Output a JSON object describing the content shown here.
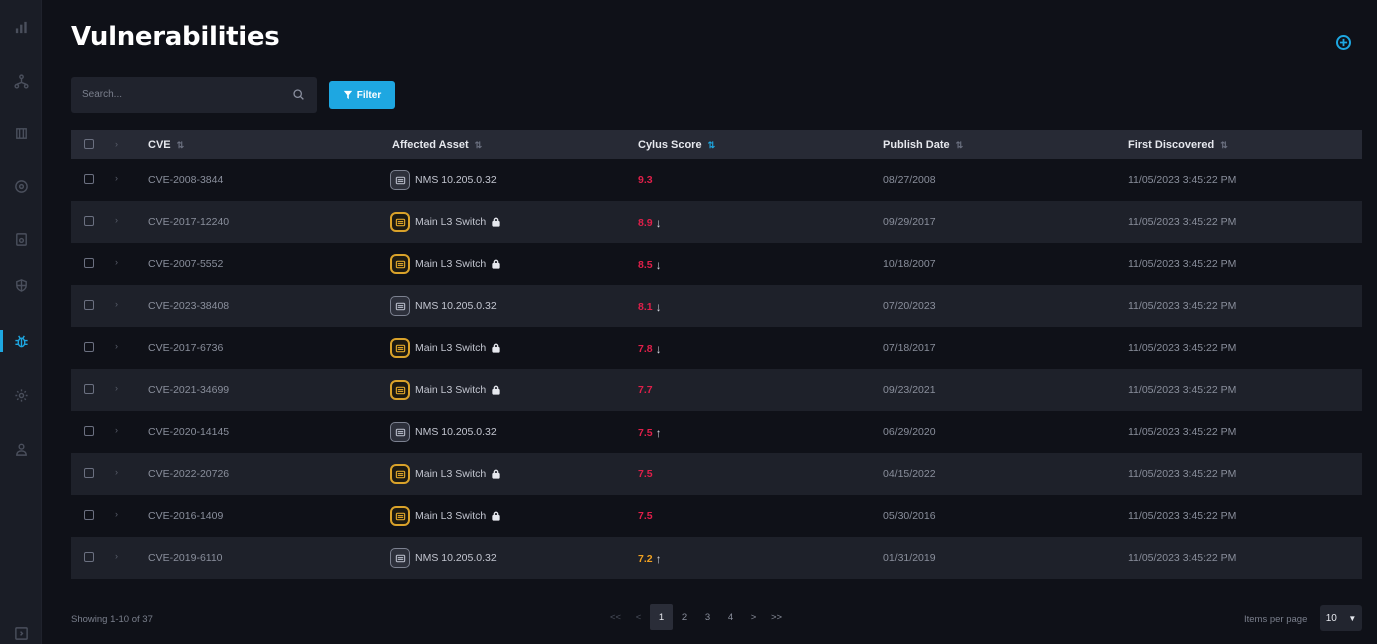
{
  "page": {
    "title": "Vulnerabilities"
  },
  "sidebar": {
    "items": [
      {
        "icon": "dashboard-icon"
      },
      {
        "icon": "topology-icon"
      },
      {
        "icon": "assets-icon"
      },
      {
        "icon": "threats-icon"
      },
      {
        "icon": "reports-icon"
      },
      {
        "icon": "protection-icon"
      },
      {
        "icon": "vulnerabilities-bug-icon",
        "active": true
      },
      {
        "icon": "settings-gear-icon"
      },
      {
        "icon": "users-icon"
      }
    ]
  },
  "search": {
    "placeholder": "Search..."
  },
  "filter": {
    "label": "Filter"
  },
  "table": {
    "columns": [
      "CVE",
      "Affected Asset",
      "Cylus Score",
      "Publish Date",
      "First Discovered"
    ],
    "rows": [
      {
        "cve": "CVE-2008-3844",
        "asset": "NMS 10.205.0.32",
        "asset_type": "gray",
        "locked": false,
        "score": "9.3",
        "color": "red",
        "trend": "",
        "publish": "08/27/2008",
        "discovered": "11/05/2023 3:45:22 PM"
      },
      {
        "cve": "CVE-2017-12240",
        "asset": "Main L3 Switch",
        "asset_type": "gold",
        "locked": true,
        "score": "8.9",
        "color": "red",
        "trend": "↓",
        "publish": "09/29/2017",
        "discovered": "11/05/2023 3:45:22 PM"
      },
      {
        "cve": "CVE-2007-5552",
        "asset": "Main L3 Switch",
        "asset_type": "gold",
        "locked": true,
        "score": "8.5",
        "color": "red",
        "trend": "↓",
        "publish": "10/18/2007",
        "discovered": "11/05/2023 3:45:22 PM"
      },
      {
        "cve": "CVE-2023-38408",
        "asset": "NMS 10.205.0.32",
        "asset_type": "gray",
        "locked": false,
        "score": "8.1",
        "color": "red",
        "trend": "↓",
        "publish": "07/20/2023",
        "discovered": "11/05/2023 3:45:22 PM"
      },
      {
        "cve": "CVE-2017-6736",
        "asset": "Main L3 Switch",
        "asset_type": "gold",
        "locked": true,
        "score": "7.8",
        "color": "red",
        "trend": "↓",
        "publish": "07/18/2017",
        "discovered": "11/05/2023 3:45:22 PM"
      },
      {
        "cve": "CVE-2021-34699",
        "asset": "Main L3 Switch",
        "asset_type": "gold",
        "locked": true,
        "score": "7.7",
        "color": "red",
        "trend": "",
        "publish": "09/23/2021",
        "discovered": "11/05/2023 3:45:22 PM"
      },
      {
        "cve": "CVE-2020-14145",
        "asset": "NMS 10.205.0.32",
        "asset_type": "gray",
        "locked": false,
        "score": "7.5",
        "color": "red",
        "trend": "↑",
        "publish": "06/29/2020",
        "discovered": "11/05/2023 3:45:22 PM"
      },
      {
        "cve": "CVE-2022-20726",
        "asset": "Main L3 Switch",
        "asset_type": "gold",
        "locked": true,
        "score": "7.5",
        "color": "red",
        "trend": "",
        "publish": "04/15/2022",
        "discovered": "11/05/2023 3:45:22 PM"
      },
      {
        "cve": "CVE-2016-1409",
        "asset": "Main L3 Switch",
        "asset_type": "gold",
        "locked": true,
        "score": "7.5",
        "color": "red",
        "trend": "",
        "publish": "05/30/2016",
        "discovered": "11/05/2023 3:45:22 PM"
      },
      {
        "cve": "CVE-2019-6110",
        "asset": "NMS 10.205.0.32",
        "asset_type": "gray",
        "locked": false,
        "score": "7.2",
        "color": "orange",
        "trend": "↑",
        "publish": "01/31/2019",
        "discovered": "11/05/2023 3:45:22 PM"
      }
    ]
  },
  "footer": {
    "showing": "Showing 1-10 of 37",
    "pager": [
      "<<",
      "<",
      "1",
      "2",
      "3",
      "4",
      ">",
      ">>"
    ],
    "current_page": "1",
    "items_per_page_label": "Items per page",
    "items_per_page_value": "10"
  },
  "colors": {
    "accent": "#1ea7e1",
    "score_red": "#e01f4a",
    "score_orange": "#f0a020",
    "asset_gold": "#d9a22a"
  }
}
